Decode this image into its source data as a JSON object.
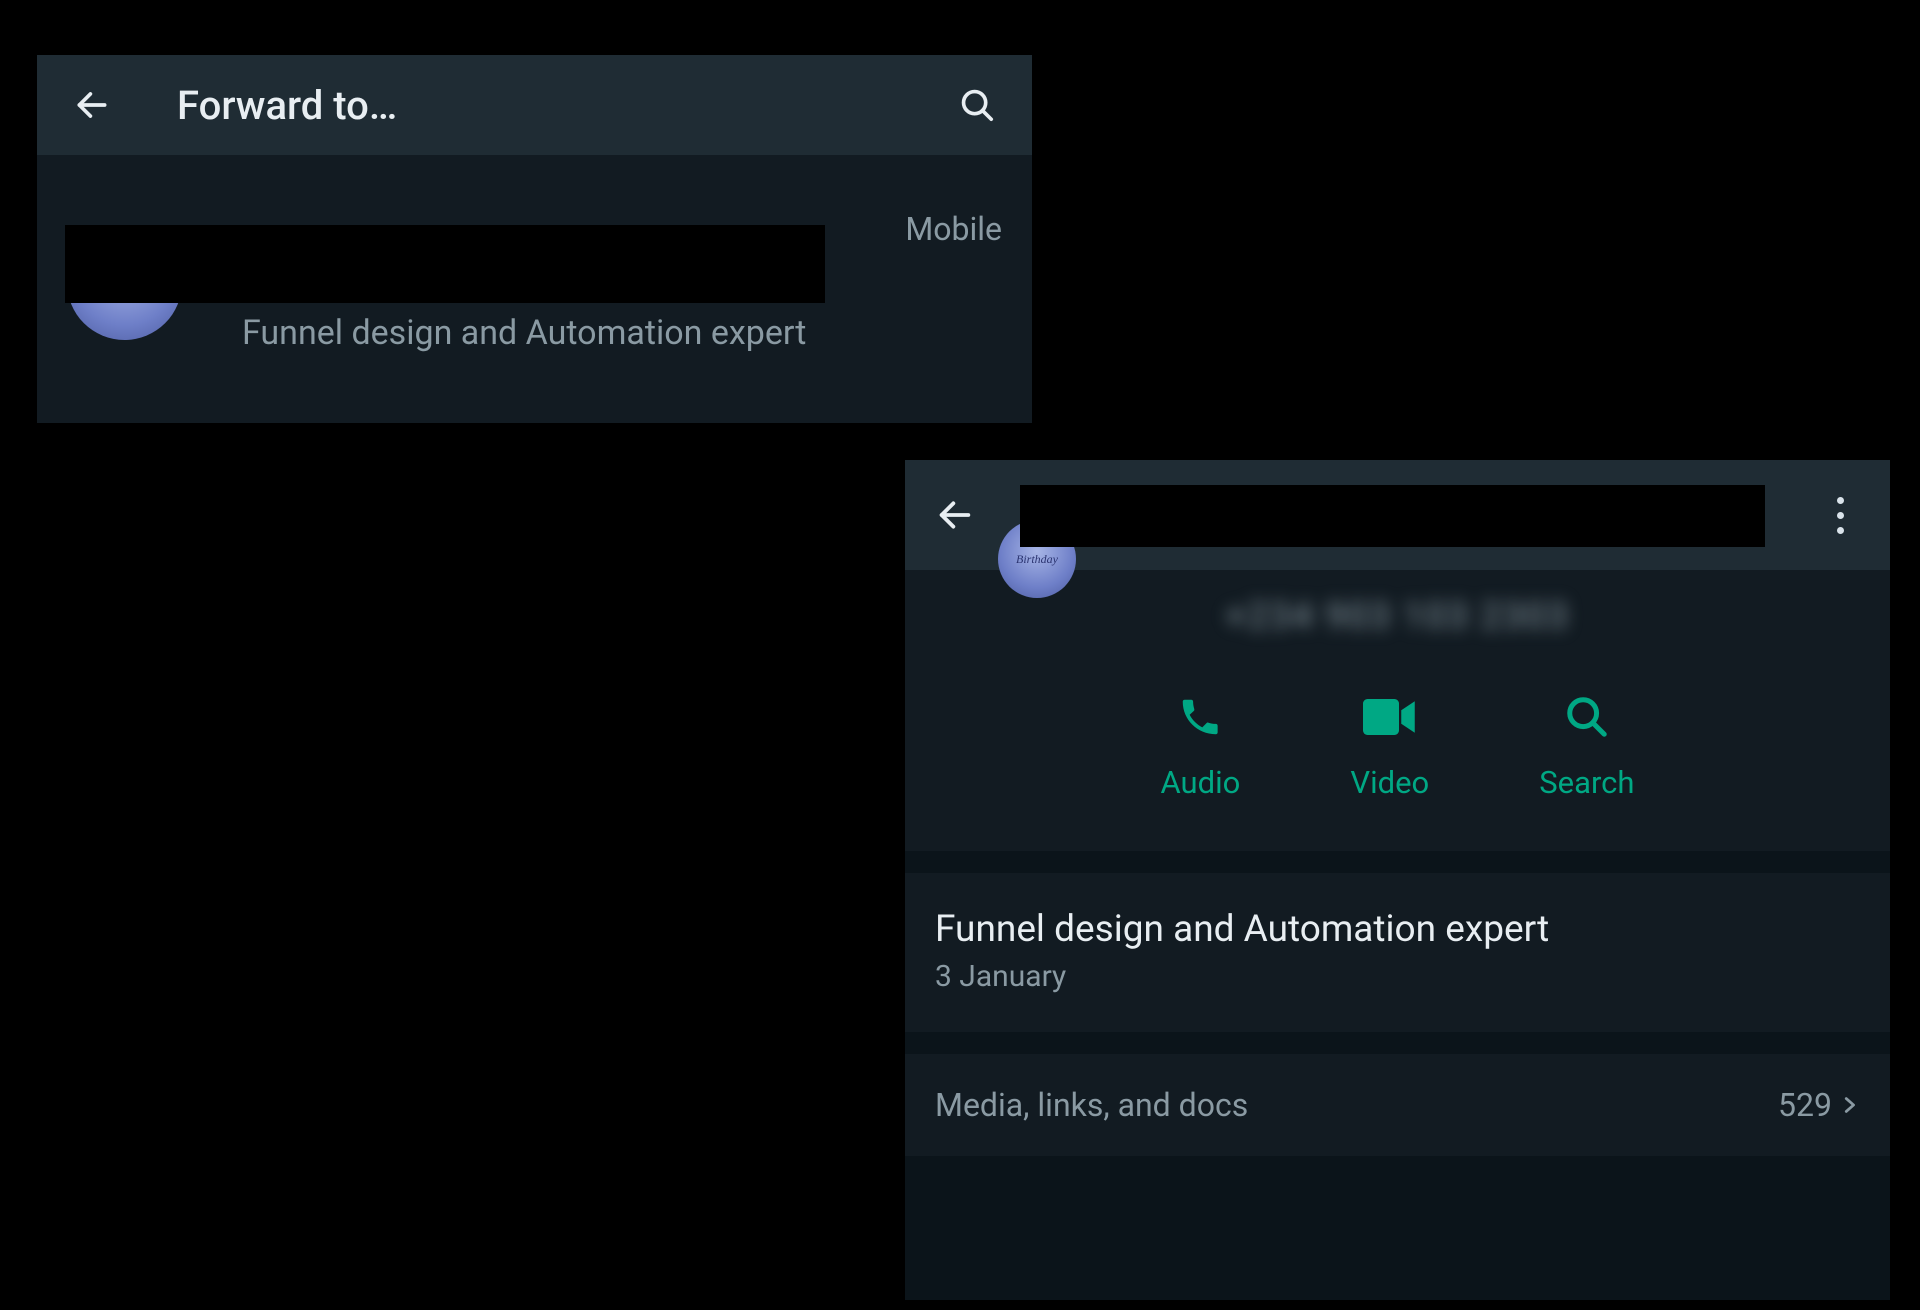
{
  "panel_forward": {
    "title": "Forward to…",
    "contact": {
      "type_label": "Mobile",
      "status": "Funnel design and Automation expert"
    }
  },
  "panel_info": {
    "phone_blurred": "+234 903 103 2303",
    "actions": {
      "audio": "Audio",
      "video": "Video",
      "search": "Search"
    },
    "about": {
      "text": "Funnel design and Automation expert",
      "date": "3 January"
    },
    "media": {
      "label": "Media, links, and docs",
      "count": "529"
    }
  }
}
